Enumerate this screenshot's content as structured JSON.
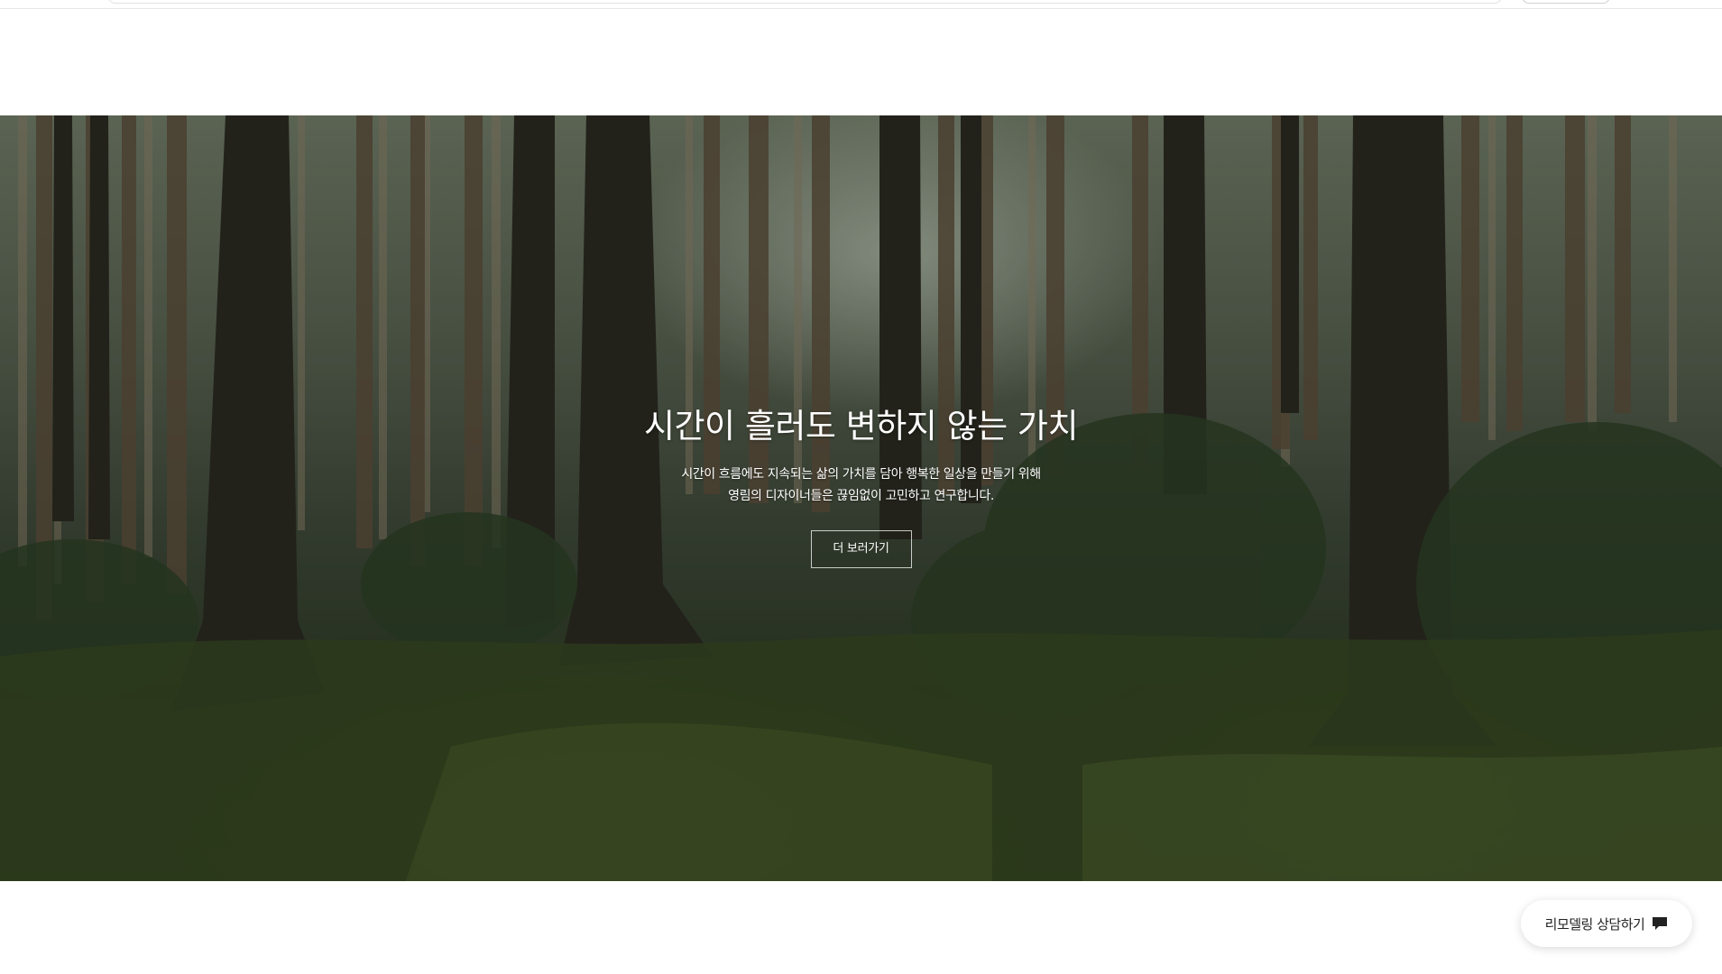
{
  "hero": {
    "title": "시간이 흘러도 변하지 않는 가치",
    "subtitle_line1": "시간이 흐름에도 지속되는 삶의 가치를 담아 행복한 일상을 만들기 위해",
    "subtitle_line2": "영림의 디자이너들은 끊임없이 고민하고 연구합니다.",
    "cta_label": "더 보러가기"
  },
  "floating": {
    "consult_label": "리모델링 상담하기",
    "icon": "chat-icon"
  }
}
